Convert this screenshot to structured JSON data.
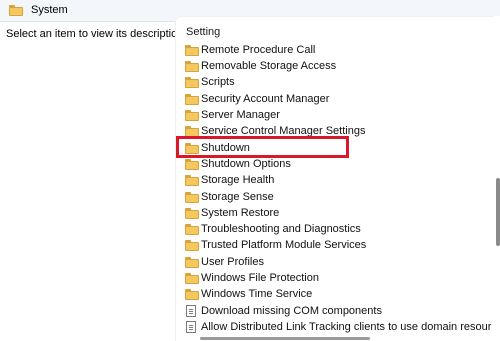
{
  "header": {
    "title": "System"
  },
  "description_text": "Select an item to view its description.",
  "column_header": "Setting",
  "items": [
    {
      "label": "Remote Procedure Call",
      "icon": "folder-icon"
    },
    {
      "label": "Removable Storage Access",
      "icon": "folder-icon"
    },
    {
      "label": "Scripts",
      "icon": "folder-icon"
    },
    {
      "label": "Security Account Manager",
      "icon": "folder-icon"
    },
    {
      "label": "Server Manager",
      "icon": "folder-icon"
    },
    {
      "label": "Service Control Manager Settings",
      "icon": "folder-icon"
    },
    {
      "label": "Shutdown",
      "icon": "folder-icon",
      "highlighted": true
    },
    {
      "label": "Shutdown Options",
      "icon": "folder-icon"
    },
    {
      "label": "Storage Health",
      "icon": "folder-icon"
    },
    {
      "label": "Storage Sense",
      "icon": "folder-icon"
    },
    {
      "label": "System Restore",
      "icon": "folder-icon"
    },
    {
      "label": "Troubleshooting and Diagnostics",
      "icon": "folder-icon"
    },
    {
      "label": "Trusted Platform Module Services",
      "icon": "folder-icon"
    },
    {
      "label": "User Profiles",
      "icon": "folder-icon"
    },
    {
      "label": "Windows File Protection",
      "icon": "folder-icon"
    },
    {
      "label": "Windows Time Service",
      "icon": "folder-icon"
    },
    {
      "label": "Download missing COM components",
      "icon": "policy-setting-icon"
    },
    {
      "label": "Allow Distributed Link Tracking clients to use domain resour",
      "icon": "policy-setting-icon"
    }
  ],
  "colors": {
    "highlight_border": "#d8192b",
    "folder": "#f4c860"
  }
}
